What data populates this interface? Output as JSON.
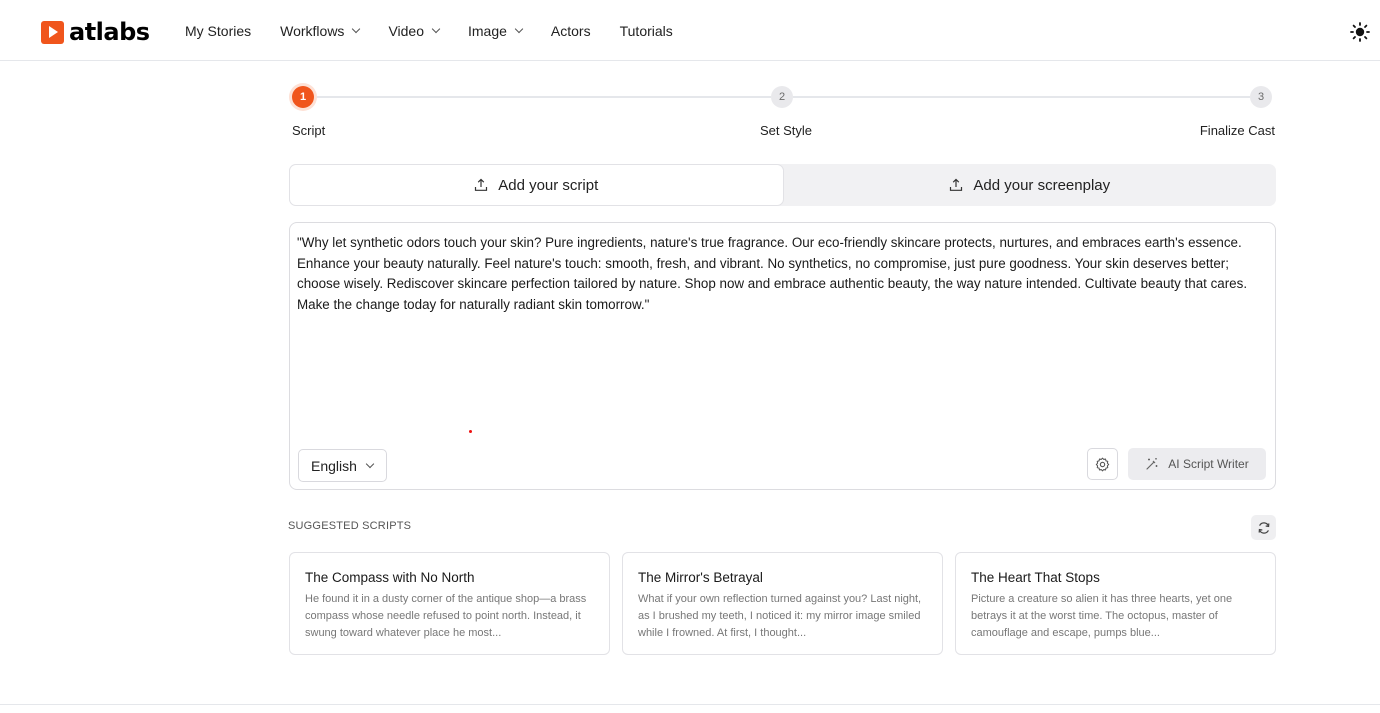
{
  "app": {
    "name": "atlabs",
    "brand_color": "#f0551c"
  },
  "nav": {
    "items": [
      {
        "label": "My Stories",
        "dropdown": false
      },
      {
        "label": "Workflows",
        "dropdown": true
      },
      {
        "label": "Video",
        "dropdown": true
      },
      {
        "label": "Image",
        "dropdown": true
      },
      {
        "label": "Actors",
        "dropdown": false
      },
      {
        "label": "Tutorials",
        "dropdown": false
      }
    ],
    "theme_icon": "sun-icon"
  },
  "stepper": {
    "steps": [
      {
        "number": "1",
        "label": "Script",
        "state": "active"
      },
      {
        "number": "2",
        "label": "Set Style",
        "state": "inactive"
      },
      {
        "number": "3",
        "label": "Finalize Cast",
        "state": "inactive"
      }
    ]
  },
  "tabs": [
    {
      "label": "Add your script",
      "active": true,
      "icon": "upload-icon"
    },
    {
      "label": "Add your screenplay",
      "active": false,
      "icon": "upload-icon"
    }
  ],
  "script": {
    "text": "\"Why let synthetic odors touch your skin? Pure ingredients, nature's true fragrance. Our eco-friendly skincare protects, nurtures, and embraces earth's essence. Enhance your beauty naturally. Feel nature's touch: smooth, fresh, and vibrant. No synthetics, no compromise, just pure goodness. Your skin deserves better; choose wisely. Rediscover skincare perfection tailored by nature. Shop now and embrace authentic beauty, the way nature intended. Cultivate beauty that cares. Make the change today for naturally radiant skin tomorrow.\"",
    "language": "English",
    "ai_writer_label": "AI Script Writer"
  },
  "suggested": {
    "title": "SUGGESTED SCRIPTS",
    "cards": [
      {
        "title": "The Compass with No North",
        "text": "He found it in a dusty corner of the antique shop—a brass compass whose needle refused to point north. Instead, it swung toward whatever place he most..."
      },
      {
        "title": "The Mirror's Betrayal",
        "text": "What if your own reflection turned against you? Last night, as I brushed my teeth, I noticed it: my mirror image smiled while I frowned. At first, I thought..."
      },
      {
        "title": "The Heart That Stops",
        "text": "Picture a creature so alien it has three hearts, yet one betrays it at the worst time. The octopus, master of camouflage and escape, pumps blue..."
      }
    ]
  }
}
